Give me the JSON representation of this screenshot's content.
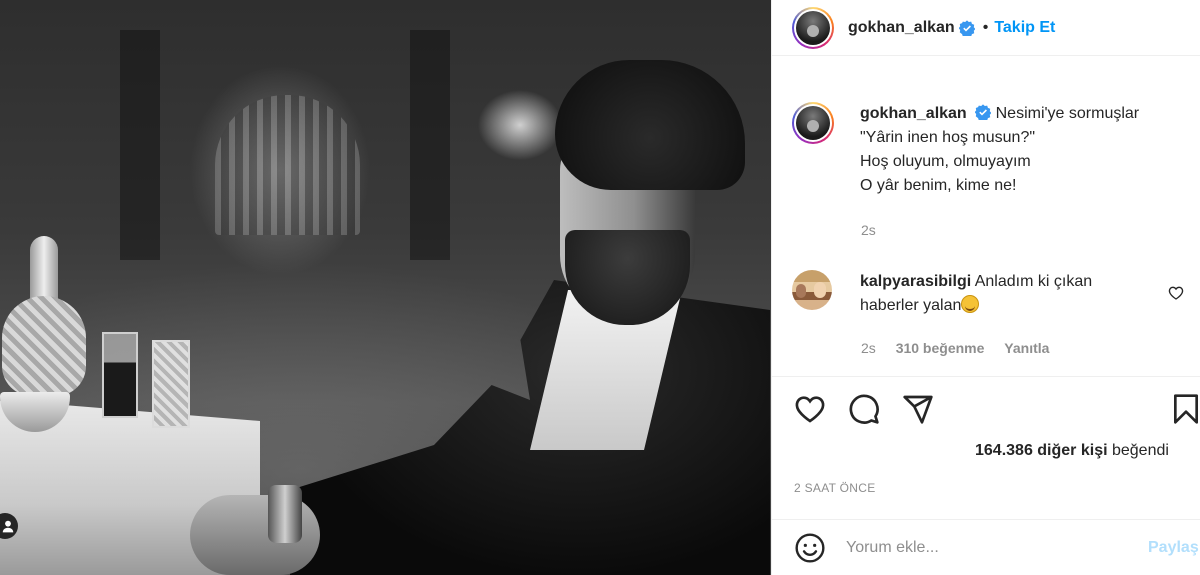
{
  "header": {
    "username": "gokhan_alkan",
    "separator": "•",
    "follow_label": "Takip Et"
  },
  "caption": {
    "username": "gokhan_alkan",
    "lines": [
      "Nesimi'ye sormuşlar",
      "\"Yârin inen hoş musun?\"",
      "Hoş oluyum, olmuyayım",
      "O yâr benim, kime ne!"
    ],
    "time": "2s"
  },
  "comment": {
    "username": "kalpyarasibilgi",
    "text_line1": "Anladım ki çıkan",
    "text_line2": "haberler yalan",
    "time": "2s",
    "likes": "310 beğenme",
    "reply_label": "Yanıtla"
  },
  "likes": {
    "count": "164.386 diğer kişi",
    "suffix": "beğendi"
  },
  "time_ago": "2 SAAT ÖNCE",
  "add_comment": {
    "placeholder": "Yorum ekle...",
    "post_label": "Paylaş"
  },
  "icons": {
    "verified": "verified-badge-icon",
    "like": "heart-icon",
    "comment": "comment-bubble-icon",
    "share": "paper-plane-icon",
    "save": "bookmark-icon",
    "emoji": "smiley-icon",
    "tag": "user-tag-icon"
  },
  "colors": {
    "accent": "#0095f6",
    "verified": "#3897f0",
    "muted": "#8e8e8e",
    "post_disabled": "#b2dffc"
  }
}
